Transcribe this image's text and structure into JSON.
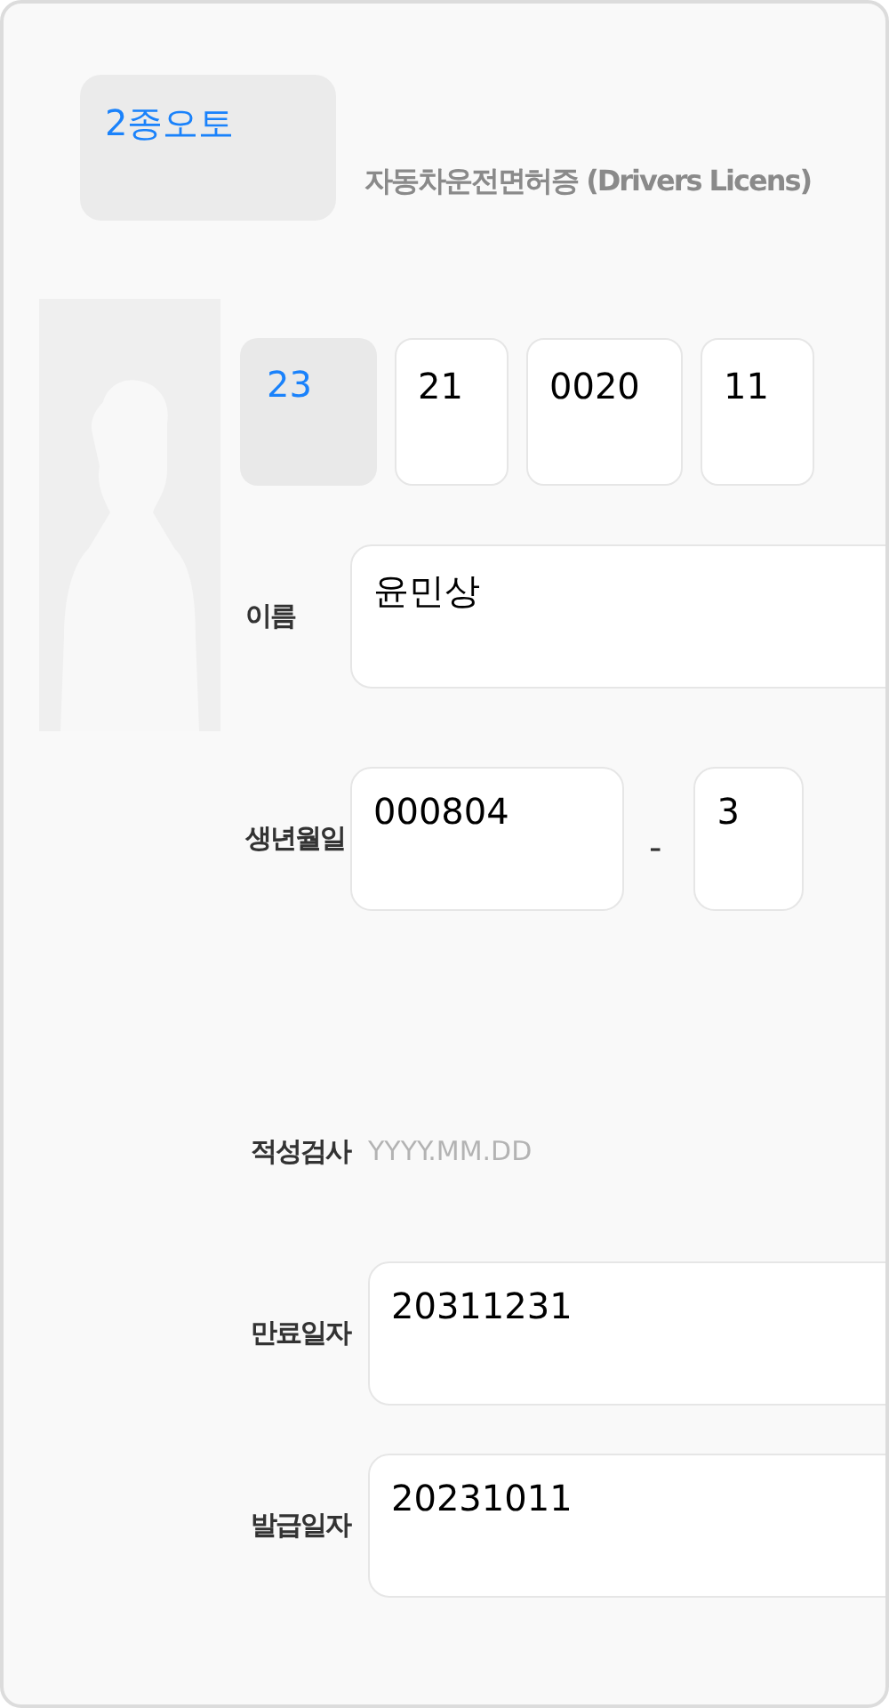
{
  "license_type": {
    "label": "2종오토"
  },
  "title": "자동차운전면허증 (Drivers Licens)",
  "license_number": [
    {
      "value": "23",
      "kind": "select"
    },
    {
      "value": "21",
      "kind": "input"
    },
    {
      "value": "0020",
      "kind": "input"
    },
    {
      "value": "11",
      "kind": "input"
    }
  ],
  "name": {
    "label": "이름",
    "value": "윤민상"
  },
  "birth": {
    "label": "생년월일",
    "front": "000804",
    "separator": "-",
    "back": "3"
  },
  "aptitude_test": {
    "label": "적성검사",
    "placeholder": "YYYY.MM.DD"
  },
  "expiry": {
    "label": "만료일자",
    "value": "20311231"
  },
  "issue": {
    "label": "발급일자",
    "value": "20231011"
  }
}
